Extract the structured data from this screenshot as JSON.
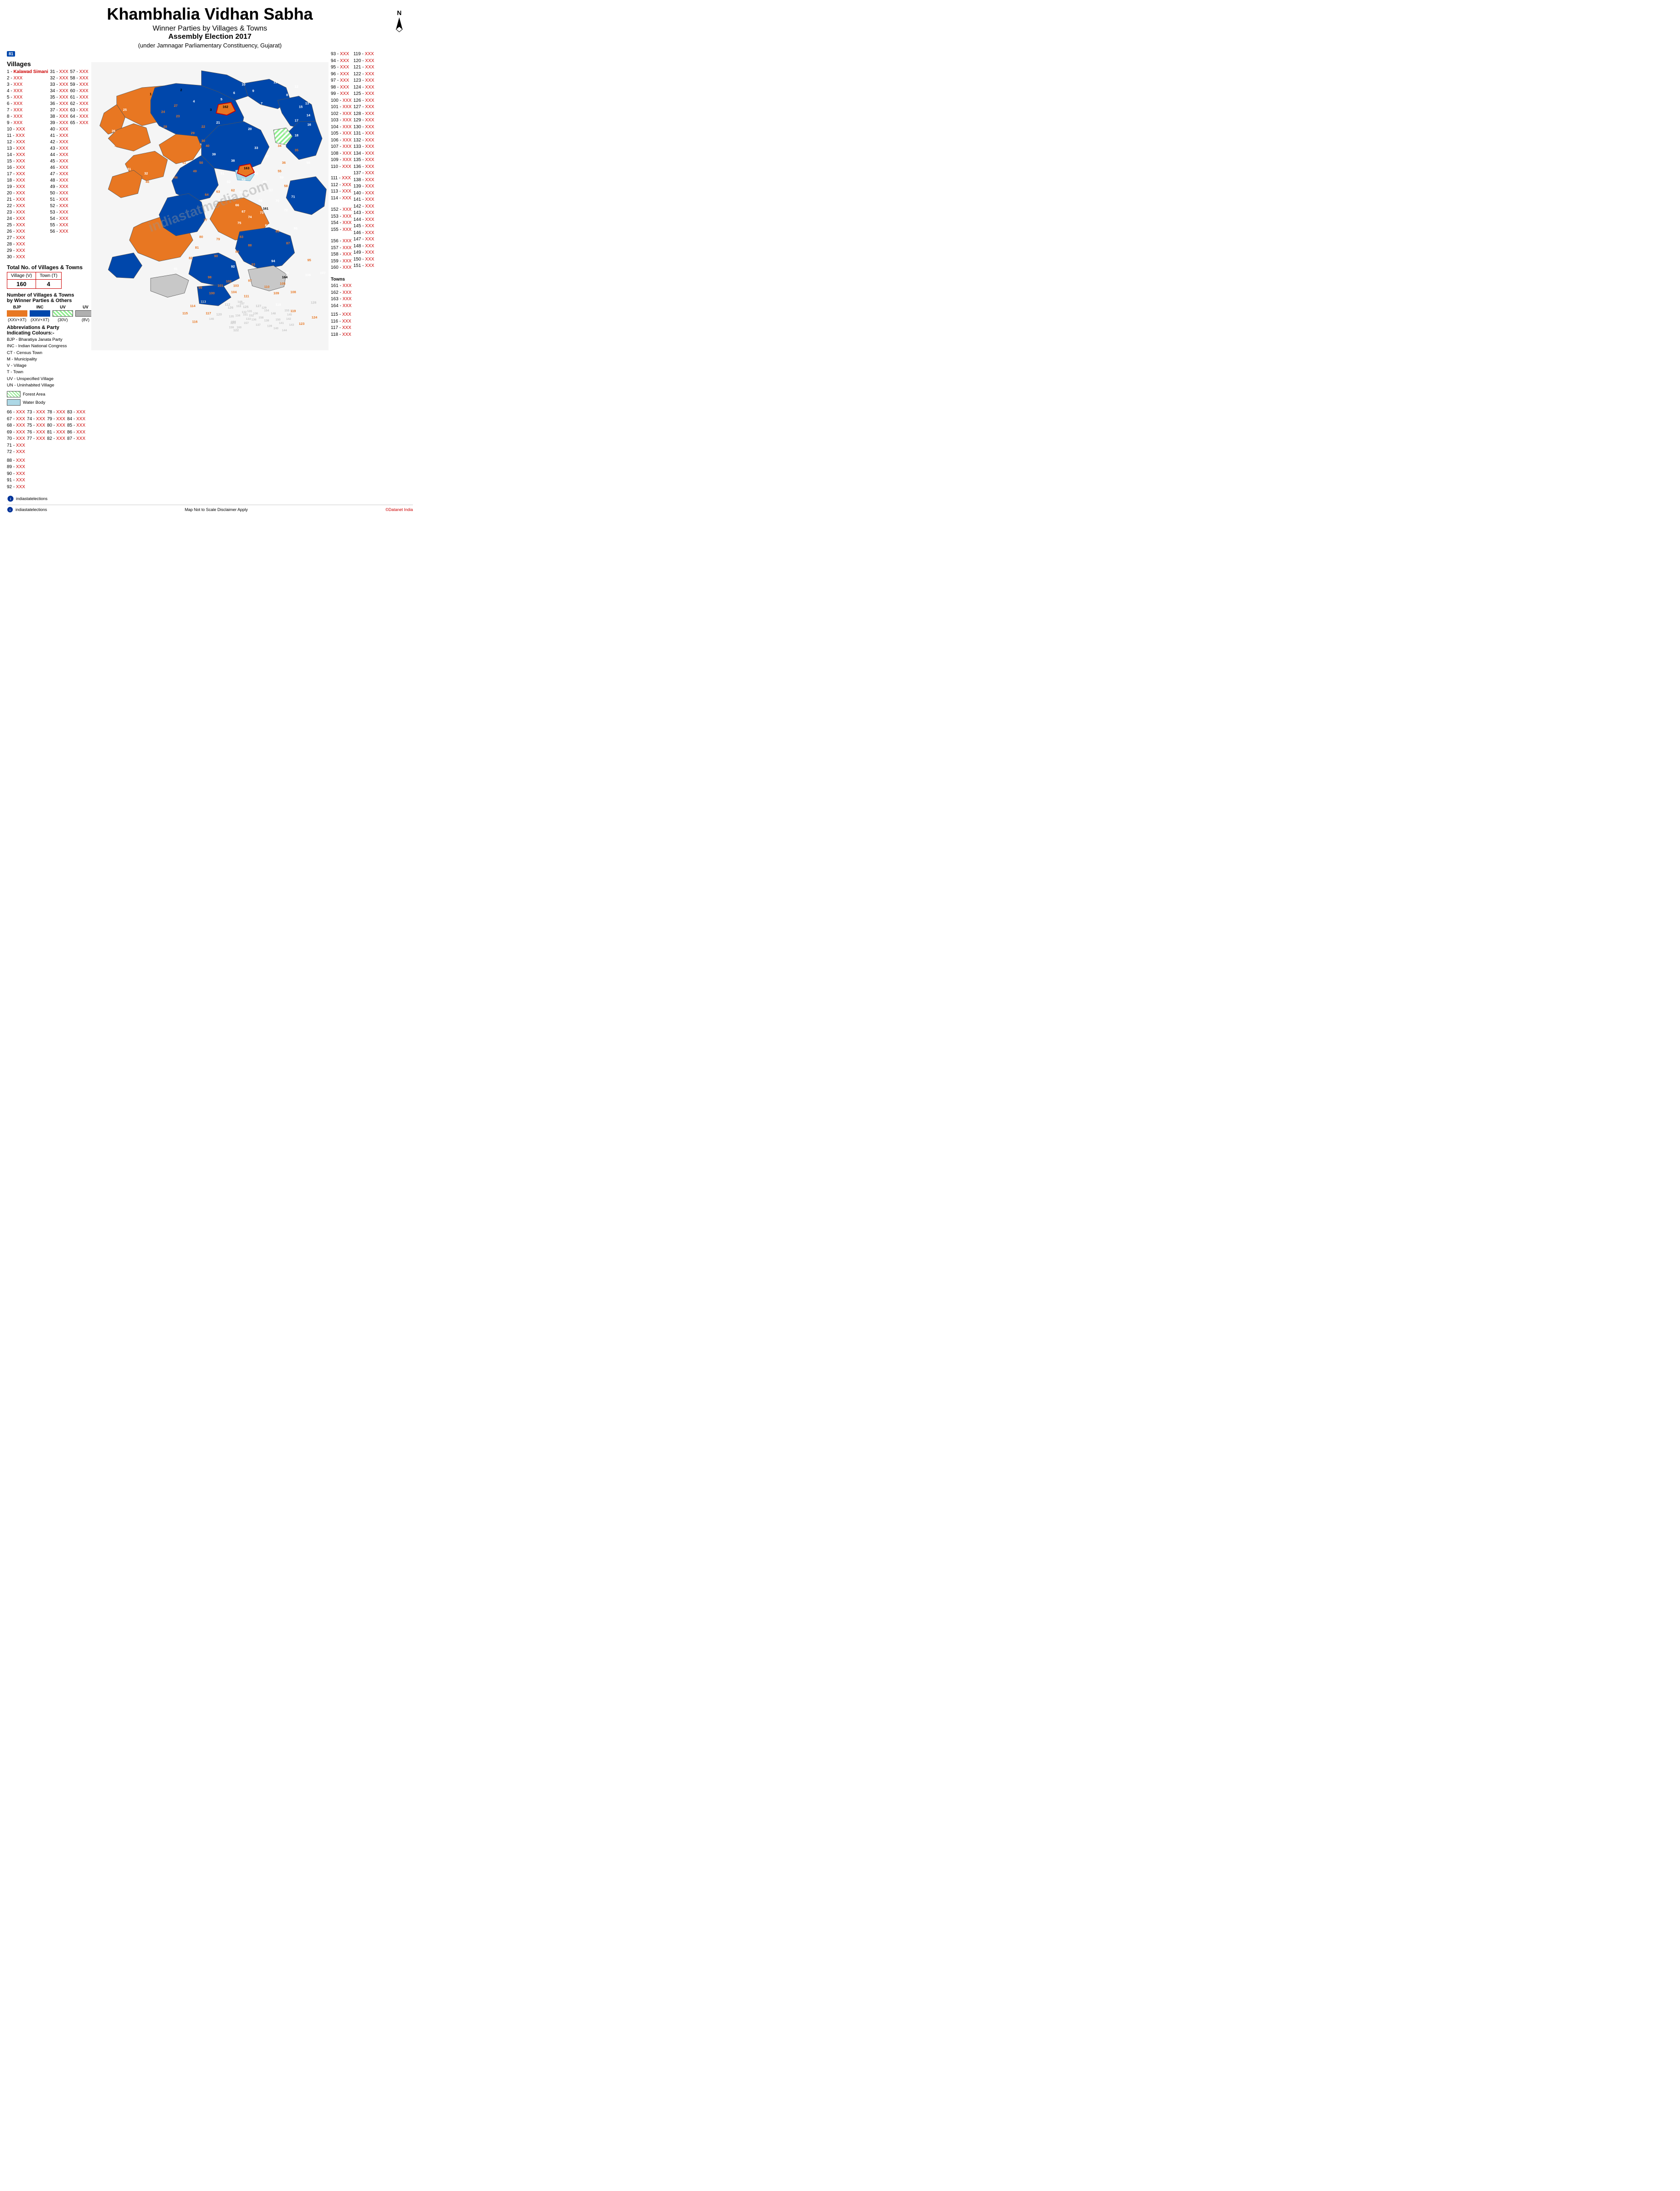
{
  "header": {
    "main_title": "Khambhalia Vidhan Sabha",
    "subtitle1": "Winner Parties by Villages & Towns",
    "subtitle2": "Assembly Election 2017",
    "subtitle3": "(under Jamnagar Parliamentary Constituency, Gujarat)"
  },
  "north_label": "N",
  "badge_81": "81",
  "villages_title": "Villages",
  "village_list_col1": [
    {
      "num": "1",
      "name": "Kalawad Simani",
      "color": "red"
    },
    {
      "num": "2",
      "xxx": true
    },
    {
      "num": "3",
      "xxx": true
    },
    {
      "num": "4",
      "xxx": true
    },
    {
      "num": "5",
      "xxx": true
    },
    {
      "num": "6",
      "xxx": true
    },
    {
      "num": "7",
      "xxx": true
    },
    {
      "num": "8",
      "xxx": true
    },
    {
      "num": "9",
      "xxx": true
    },
    {
      "num": "10",
      "xxx": true
    },
    {
      "num": "11",
      "xxx": true
    },
    {
      "num": "12",
      "xxx": true
    },
    {
      "num": "13",
      "xxx": true
    },
    {
      "num": "14",
      "xxx": true
    },
    {
      "num": "15",
      "xxx": true
    },
    {
      "num": "16",
      "xxx": true
    },
    {
      "num": "17",
      "xxx": true
    },
    {
      "num": "18",
      "xxx": true
    },
    {
      "num": "19",
      "xxx": true
    },
    {
      "num": "20",
      "xxx": true
    },
    {
      "num": "21",
      "xxx": true
    },
    {
      "num": "22",
      "xxx": true
    },
    {
      "num": "23",
      "xxx": true
    },
    {
      "num": "24",
      "xxx": true
    },
    {
      "num": "25",
      "xxx": true
    },
    {
      "num": "26",
      "xxx": true
    },
    {
      "num": "27",
      "xxx": true
    },
    {
      "num": "28",
      "xxx": true
    },
    {
      "num": "29",
      "xxx": true
    },
    {
      "num": "30",
      "xxx": true
    }
  ],
  "village_list_col2": [
    {
      "num": "31",
      "xxx": true
    },
    {
      "num": "32",
      "xxx": true
    },
    {
      "num": "33",
      "xxx": true
    },
    {
      "num": "34",
      "xxx": true
    },
    {
      "num": "35",
      "xxx": true
    },
    {
      "num": "36",
      "xxx": true
    },
    {
      "num": "37",
      "xxx": true
    },
    {
      "num": "38",
      "xxx": true
    },
    {
      "num": "39",
      "xxx": true
    },
    {
      "num": "40",
      "xxx": true
    },
    {
      "num": "41",
      "xxx": true
    },
    {
      "num": "42",
      "xxx": true
    },
    {
      "num": "43",
      "xxx": true
    },
    {
      "num": "44",
      "xxx": true
    },
    {
      "num": "45",
      "xxx": true
    },
    {
      "num": "46",
      "xxx": true
    },
    {
      "num": "47",
      "xxx": true
    },
    {
      "num": "48",
      "xxx": true
    },
    {
      "num": "49",
      "xxx": true
    },
    {
      "num": "50",
      "xxx": true
    },
    {
      "num": "51",
      "xxx": true
    },
    {
      "num": "52",
      "xxx": true
    },
    {
      "num": "53",
      "xxx": true
    },
    {
      "num": "54",
      "xxx": true
    },
    {
      "num": "55",
      "xxx": true
    },
    {
      "num": "56",
      "xxx": true
    }
  ],
  "village_list_col3": [
    {
      "num": "57",
      "xxx": true
    },
    {
      "num": "58",
      "xxx": true
    },
    {
      "num": "59",
      "xxx": true
    },
    {
      "num": "60",
      "xxx": true
    },
    {
      "num": "61",
      "xxx": true
    },
    {
      "num": "62",
      "xxx": true
    },
    {
      "num": "63",
      "xxx": true
    },
    {
      "num": "64",
      "xxx": true
    },
    {
      "num": "65",
      "xxx": true
    }
  ],
  "village_list_col4_header": [
    "44 - XXX",
    "45 - XXX",
    "46 - XXX",
    "47 - XXX",
    "48 - XXX"
  ],
  "village_list_col5_header": [
    "57 - XXX",
    "58 - XXX",
    "59 - XXX"
  ],
  "totals": {
    "title": "Total No. of Villages & Towns",
    "village_label": "Village (V)",
    "village_count": "160",
    "town_label": "Town (T)",
    "town_count": "4"
  },
  "winner_section": {
    "title": "Number of Villages & Towns",
    "subtitle": "by Winner Parties & Others",
    "parties": [
      {
        "label": "BJP",
        "count": "(XXV+XT)"
      },
      {
        "label": "INC",
        "count": "(XXV+XT)"
      },
      {
        "label": "UV",
        "count": "(30V)"
      },
      {
        "label": "UV",
        "count": "(8V)"
      }
    ]
  },
  "abbreviations": {
    "title": "Abbreviations & Party",
    "subtitle": "Indicating Colours:-",
    "bjp": "BJP - Bharatiya Janata Party",
    "inc": "INC - Indian National Congress",
    "items": [
      "CT  - Census Town",
      "M   - Municipality",
      "V   - Village",
      "T   - Town",
      "UV  - Unspecified Village",
      "UN  - Uninhabited Village"
    ]
  },
  "map_legend": {
    "forest": "Forest Area",
    "water": "Water Body"
  },
  "right_numbers_col1": [
    "93 - XXX",
    "94 - XXX",
    "95 - XXX",
    "96 - XXX",
    "97 - XXX",
    "98 - XXX",
    "99 - XXX",
    "100 - XXX",
    "101 - XXX",
    "102 - XXX",
    "103 - XXX",
    "104 - XXX",
    "105 - XXX",
    "106 - XXX",
    "107 - XXX",
    "108 - XXX",
    "109 - XXX",
    "110 - XXX"
  ],
  "right_numbers_col2": [
    "119 - XXX",
    "120 - XXX",
    "121 - XXX",
    "122 - XXX",
    "123 - XXX",
    "124 - XXX",
    "125 - XXX",
    "126 - XXX",
    "127 - XXX",
    "128 - XXX",
    "129 - XXX",
    "130 - XXX",
    "131 - XXX",
    "132 - XXX",
    "133 - XXX",
    "134 - XXX",
    "135 - XXX",
    "136 - XXX",
    "137 - XXX",
    "138 - XXX",
    "139 - XXX",
    "140 - XXX",
    "141 - XXX",
    "142 - XXX",
    "143 - XXX",
    "144 - XXX",
    "145 - XXX",
    "146 - XXX",
    "147 - XXX",
    "148 - XXX",
    "149 - XXX",
    "150 - XXX",
    "151 - XXX",
    "152 - XXX",
    "153 - XXX",
    "154 - XXX",
    "155 - XXX"
  ],
  "right_numbers_col3_111": [
    "111 - XXX",
    "112 - XXX",
    "113 - XXX",
    "114 - XXX"
  ],
  "right_numbers_col3_152": [
    "152 - XXX",
    "153 - XXX",
    "154 - XXX",
    "155 - XXX"
  ],
  "bottom_right_numbers": [
    "156 - XXX",
    "157 - XXX",
    "158 - XXX",
    "159 - XXX",
    "160 - XXX"
  ],
  "towns_title": "Towns",
  "towns": [
    "161 - XXX",
    "162 - XXX",
    "163 - XXX",
    "164 - XXX"
  ],
  "bottom_villages_66": [
    "66 - XXX",
    "67 - XXX",
    "68 - XXX",
    "69 - XXX",
    "70 - XXX",
    "71 - XXX",
    "72 - XXX"
  ],
  "bottom_villages_73": [
    "73 - XXX",
    "74 - XXX",
    "75 - XXX",
    "76 - XXX",
    "77 - XXX"
  ],
  "bottom_villages_78": [
    "78 - XXX",
    "79 - XXX",
    "80 - XXX",
    "81 - XXX",
    "82 - XXX"
  ],
  "bottom_villages_83": [
    "83 - XXX",
    "84 - XXX",
    "85 - XXX",
    "86 - XXX",
    "87 - XXX"
  ],
  "bottom_villages_88": [
    "88 - XXX",
    "89 - XXX",
    "90 - XXX",
    "91 - XXX",
    "92 - XXX"
  ],
  "bottom_villages_115": [
    "115 - XXX",
    "116 - XXX",
    "117 - XXX",
    "118 - XXX"
  ],
  "footer": {
    "left": "indiastatelections",
    "center": "Map Not to Scale    Disclaimer Apply",
    "right": "©Datanet India"
  }
}
